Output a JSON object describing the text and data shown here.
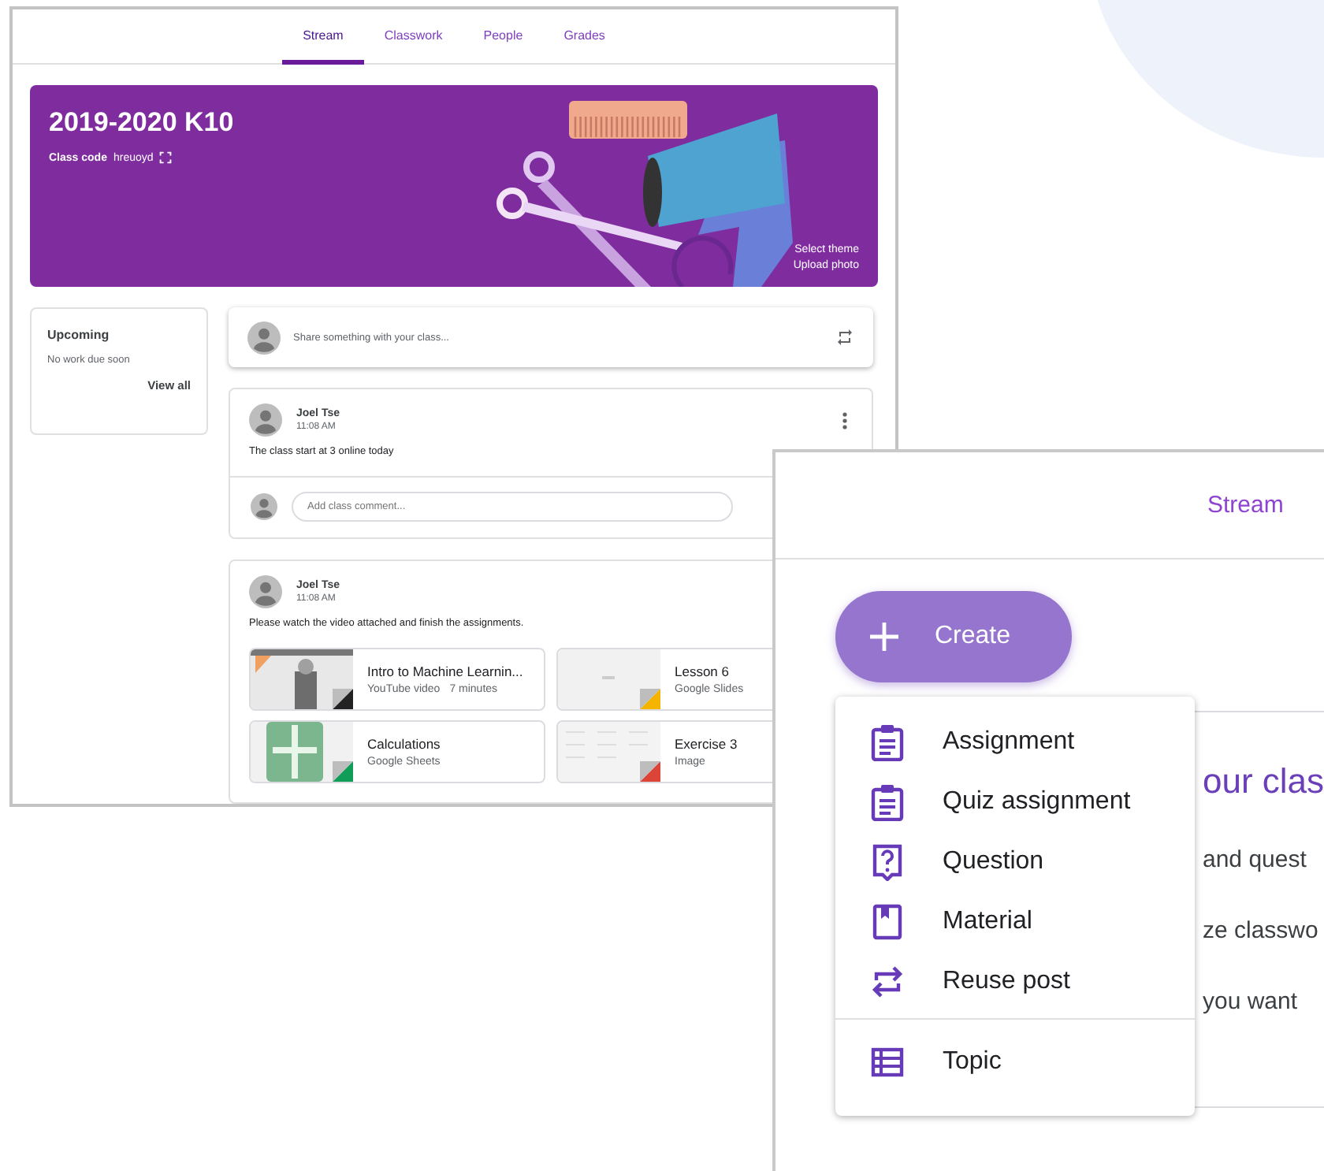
{
  "stream_window": {
    "tabs": [
      {
        "label": "Stream",
        "selected": true
      },
      {
        "label": "Classwork",
        "selected": false
      },
      {
        "label": "People",
        "selected": false
      },
      {
        "label": "Grades",
        "selected": false
      }
    ],
    "banner": {
      "title": "2019-2020 K10",
      "class_code_label": "Class code",
      "class_code": "hreuoyd",
      "links": [
        "Select theme",
        "Upload photo"
      ]
    },
    "upcoming": {
      "title": "Upcoming",
      "message": "No work due soon",
      "link": "View all"
    },
    "share": {
      "placeholder": "Share something with your class..."
    },
    "posts": [
      {
        "author": "Joel Tse",
        "time": "11:08 AM",
        "text": "The class start at 3 online today",
        "options_menu": true,
        "comment_placeholder": "Add class comment..."
      },
      {
        "author": "Joel Tse",
        "time": "11:08 AM",
        "text": "Please watch the video attached and finish the assignments.",
        "attachments": [
          {
            "kind": "video",
            "title": "Intro to Machine Learnin...",
            "subtitle": "YouTube video",
            "duration": "7 minutes"
          },
          {
            "kind": "slides",
            "title": "Lesson 6",
            "subtitle": "Google Slides"
          },
          {
            "kind": "sheets",
            "title": "Calculations",
            "subtitle": "Google Sheets"
          },
          {
            "kind": "image",
            "title": "Exercise 3",
            "subtitle": "Image"
          }
        ]
      }
    ]
  },
  "classwork_window": {
    "tabs": [
      {
        "label": "Stream",
        "selected": false
      }
    ],
    "create_button": {
      "label": "Create"
    },
    "create_menu": {
      "items": [
        {
          "kind": "assignment",
          "label": "Assignment"
        },
        {
          "kind": "assignment",
          "label": "Quiz assignment"
        },
        {
          "kind": "question",
          "label": "Question"
        },
        {
          "kind": "material",
          "label": "Material"
        },
        {
          "kind": "reuse",
          "label": "Reuse post"
        },
        {
          "kind": "topic",
          "label": "Topic"
        }
      ]
    },
    "background_card": {
      "heading": "our clas",
      "lines": [
        "and quest",
        "ze classwo",
        "you want"
      ]
    }
  }
}
